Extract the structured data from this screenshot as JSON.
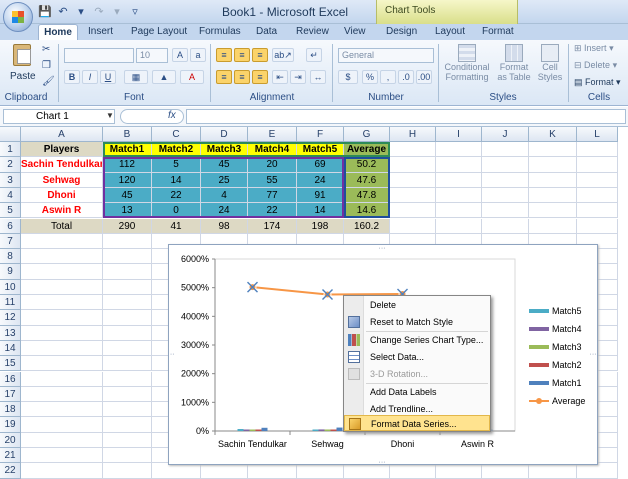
{
  "window": {
    "title": "Book1 - Microsoft Excel",
    "context_tab": "Chart Tools"
  },
  "tabs": [
    "Home",
    "Insert",
    "Page Layout",
    "Formulas",
    "Data",
    "Review",
    "View",
    "Design",
    "Layout",
    "Format"
  ],
  "ribbon": {
    "clipboard": {
      "label": "Clipboard",
      "paste": "Paste"
    },
    "font": {
      "label": "Font",
      "size": "10"
    },
    "alignment": {
      "label": "Alignment"
    },
    "number": {
      "label": "Number",
      "format": "General"
    },
    "styles": {
      "label": "Styles",
      "conditional": [
        "Conditional",
        "Formatting"
      ],
      "format_table": [
        "Format",
        "as Table"
      ],
      "cell_styles": [
        "Cell",
        "Styles"
      ]
    },
    "cells": {
      "label": "Cells",
      "insert": "Insert",
      "delete": "Delete",
      "format": "Format"
    }
  },
  "formula_bar": {
    "name_box": "Chart 1",
    "fx": "fx",
    "value": ""
  },
  "columns": [
    "A",
    "B",
    "C",
    "D",
    "E",
    "F",
    "G",
    "H",
    "I",
    "J",
    "K",
    "L"
  ],
  "rows": [
    "1",
    "2",
    "3",
    "4",
    "5",
    "6",
    "7",
    "8",
    "9",
    "10",
    "11",
    "12",
    "13",
    "14",
    "15",
    "16",
    "17",
    "18",
    "19",
    "20",
    "21",
    "22"
  ],
  "table": {
    "headers": [
      "Players",
      "Match1",
      "Match2",
      "Match3",
      "Match4",
      "Match5",
      "Average"
    ],
    "data": [
      [
        "Sachin Tendulkar",
        "112",
        "5",
        "45",
        "20",
        "69",
        "50.2"
      ],
      [
        "Sehwag",
        "120",
        "14",
        "25",
        "55",
        "24",
        "47.6"
      ],
      [
        "Dhoni",
        "45",
        "22",
        "4",
        "77",
        "91",
        "47.8"
      ],
      [
        "Aswin R",
        "13",
        "0",
        "24",
        "22",
        "14",
        "14.6"
      ]
    ],
    "total": [
      "Total",
      "290",
      "41",
      "98",
      "174",
      "198",
      "160.2"
    ]
  },
  "chart_data": {
    "type": "line",
    "categories": [
      "Sachin Tendulkar",
      "Sehwag",
      "Dhoni",
      "Aswin R"
    ],
    "y_ticks": [
      "6000%",
      "5000%",
      "4000%",
      "3000%",
      "2000%",
      "1000%",
      "0%"
    ],
    "ylim": [
      0,
      60
    ],
    "series": [
      {
        "name": "Match5",
        "color": "#4bacc6",
        "values": [
          69,
          24,
          91,
          14
        ]
      },
      {
        "name": "Match4",
        "color": "#8064a2",
        "values": [
          20,
          55,
          77,
          22
        ]
      },
      {
        "name": "Match3",
        "color": "#9bbb59",
        "values": [
          45,
          25,
          4,
          24
        ]
      },
      {
        "name": "Match2",
        "color": "#c0504d",
        "values": [
          5,
          14,
          22,
          0
        ]
      },
      {
        "name": "Match1",
        "color": "#4f81bd",
        "values": [
          112,
          120,
          45,
          13
        ]
      },
      {
        "name": "Average",
        "color": "#f79646",
        "values": [
          50.2,
          47.6,
          47.8,
          14.6
        ]
      }
    ]
  },
  "context_menu": {
    "items": [
      "Delete",
      "Reset to Match Style",
      "Change Series Chart Type...",
      "Select Data...",
      "3-D Rotation...",
      "Add Data Labels",
      "Add Trendline...",
      "Format Data Series..."
    ]
  },
  "colors": {
    "header_yellow": "#ffff00",
    "player_red": "#ff0000",
    "cell_teal": "#4bacc6",
    "avg_green": "#9bbb59",
    "header_tan": "#ddd9c4",
    "menu_highlight": "#ffe38f"
  }
}
